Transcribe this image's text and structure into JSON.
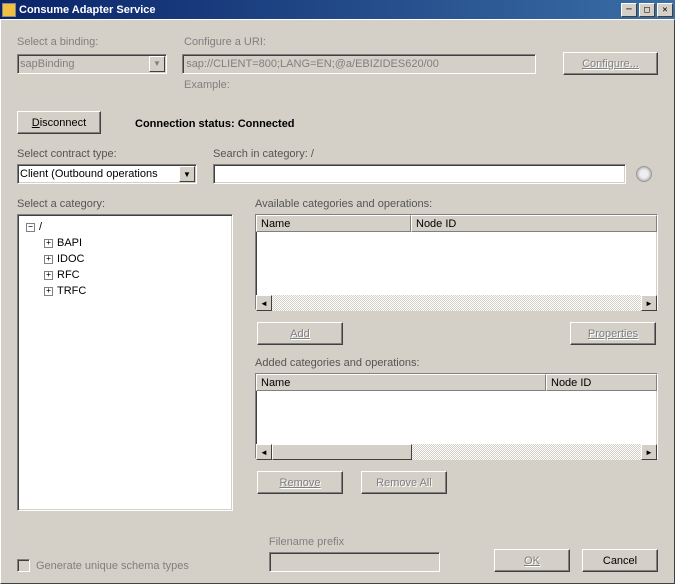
{
  "title": "Consume Adapter Service",
  "binding": {
    "label": "Select a binding:",
    "value": "sapBinding"
  },
  "uri": {
    "label": "Configure a URI:",
    "value": "sap://CLIENT=800;LANG=EN;@a/EBIZIDES620/00",
    "example_label": "Example:"
  },
  "configure_btn": "Configure...",
  "disconnect_btn": "Disconnect",
  "status_label": "Connection status:",
  "status_value": "Connected",
  "contract": {
    "label": "Select contract type:",
    "value": "Client (Outbound operations"
  },
  "search": {
    "label": "Search in category: /",
    "value": ""
  },
  "category": {
    "label": "Select a category:",
    "root": "/",
    "items": [
      "BAPI",
      "IDOC",
      "RFC",
      "TRFC"
    ]
  },
  "available": {
    "label": "Available categories and operations:",
    "col_name": "Name",
    "col_node": "Node ID"
  },
  "add_btn": "Add",
  "properties_btn": "Properties",
  "added": {
    "label": "Added categories and operations:",
    "col_name": "Name",
    "col_node": "Node ID"
  },
  "remove_btn": "Remove",
  "remove_all_btn": "Remove All",
  "filename_label": "Filename prefix",
  "gen_schema_label": "Generate unique schema types",
  "ok_btn": "OK",
  "cancel_btn": "Cancel"
}
